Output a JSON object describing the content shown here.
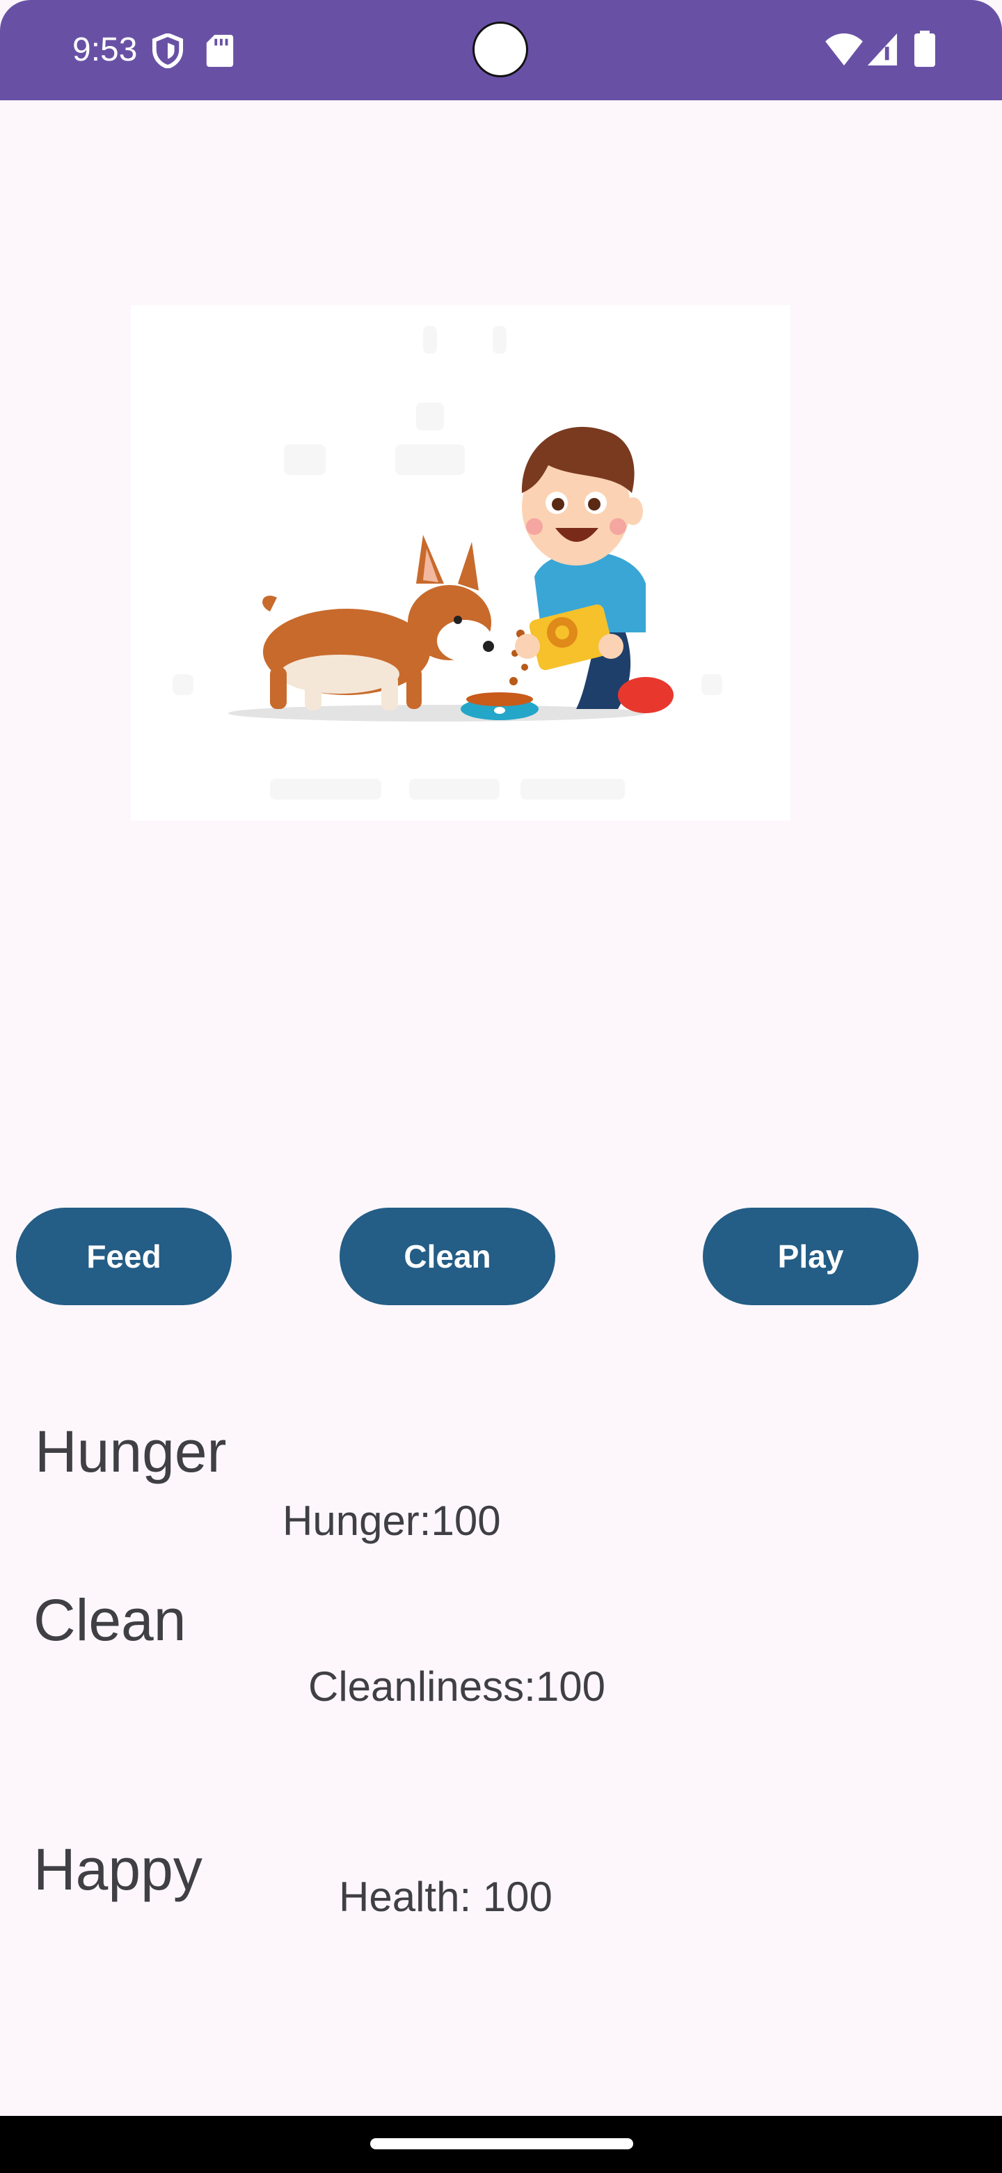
{
  "status_bar": {
    "time": "9:53",
    "icons": [
      "shield-icon",
      "sd-card-icon",
      "wifi-icon",
      "signal-icon",
      "battery-icon"
    ]
  },
  "pet_image": {
    "description": "boy-feeding-corgi-illustration"
  },
  "actions": {
    "feed_label": "Feed",
    "clean_label": "Clean",
    "play_label": "Play"
  },
  "stats": {
    "hunger_title": "Hunger",
    "hunger_value": "Hunger:100",
    "clean_title": "Clean",
    "clean_value": "Cleanliness:100",
    "happy_title": "Happy",
    "happy_value": "Health: 100"
  },
  "colors": {
    "status_bar": "#6851a5",
    "button": "#245d86",
    "background": "#fdf7fc",
    "text": "#3f3f44"
  }
}
